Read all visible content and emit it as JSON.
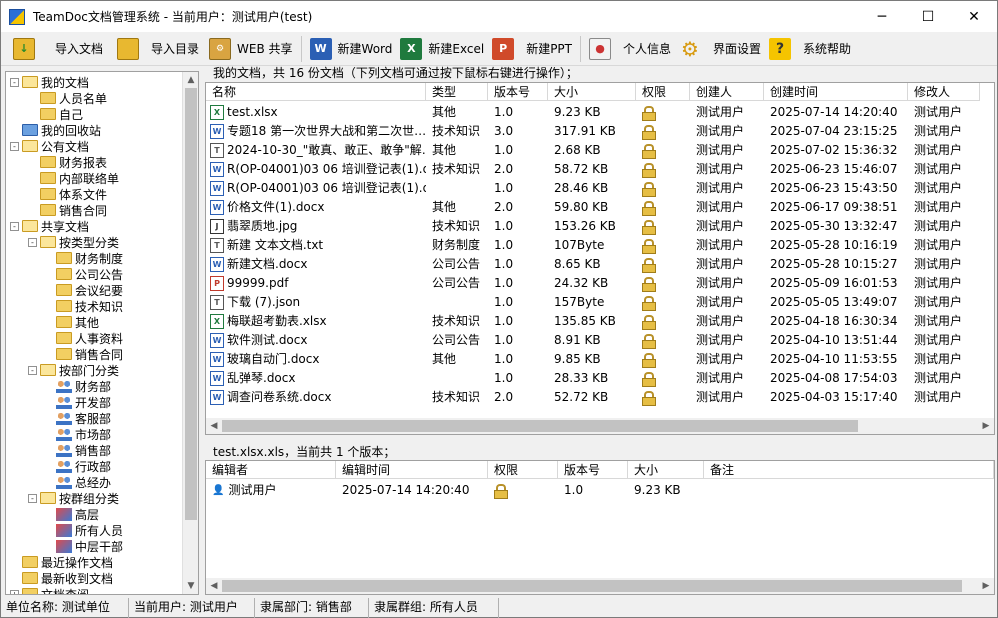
{
  "window": {
    "title": "TeamDoc文档管理系统 - 当前用户：测试用户(test)",
    "minimize": "─",
    "maximize": "☐",
    "close": "✕"
  },
  "toolbar": {
    "items": [
      {
        "label": "导入文档",
        "icon": "import-doc-icon"
      },
      {
        "label": "导入目录",
        "icon": "import-folder-icon"
      },
      {
        "label": "WEB 共享",
        "icon": "web-share-icon"
      },
      {
        "label": "新建Word",
        "icon": "word-icon"
      },
      {
        "label": "新建Excel",
        "icon": "excel-icon"
      },
      {
        "label": "新建PPT",
        "icon": "ppt-icon"
      },
      {
        "label": "个人信息",
        "icon": "user-info-icon"
      },
      {
        "label": "界面设置",
        "icon": "gear-icon"
      },
      {
        "label": "系统帮助",
        "icon": "help-icon"
      }
    ]
  },
  "tree": {
    "nodes": [
      {
        "label": "我的文档",
        "level": 0,
        "exp": "-",
        "icon": "folder-open"
      },
      {
        "label": "人员名单",
        "level": 1,
        "exp": "",
        "icon": "folder"
      },
      {
        "label": "自己",
        "level": 1,
        "exp": "",
        "icon": "folder"
      },
      {
        "label": "我的回收站",
        "level": 0,
        "exp": "",
        "icon": "recycle"
      },
      {
        "label": "公有文档",
        "level": 0,
        "exp": "-",
        "icon": "folder-open"
      },
      {
        "label": "财务报表",
        "level": 1,
        "exp": "",
        "icon": "folder"
      },
      {
        "label": "内部联络单",
        "level": 1,
        "exp": "",
        "icon": "folder"
      },
      {
        "label": "体系文件",
        "level": 1,
        "exp": "",
        "icon": "folder"
      },
      {
        "label": "销售合同",
        "level": 1,
        "exp": "",
        "icon": "folder"
      },
      {
        "label": "共享文档",
        "level": 0,
        "exp": "-",
        "icon": "folder-open"
      },
      {
        "label": "按类型分类",
        "level": 1,
        "exp": "-",
        "icon": "folder-open"
      },
      {
        "label": "财务制度",
        "level": 2,
        "exp": "",
        "icon": "folder"
      },
      {
        "label": "公司公告",
        "level": 2,
        "exp": "",
        "icon": "folder"
      },
      {
        "label": "会议纪要",
        "level": 2,
        "exp": "",
        "icon": "folder"
      },
      {
        "label": "技术知识",
        "level": 2,
        "exp": "",
        "icon": "folder"
      },
      {
        "label": "其他",
        "level": 2,
        "exp": "",
        "icon": "folder"
      },
      {
        "label": "人事资料",
        "level": 2,
        "exp": "",
        "icon": "folder"
      },
      {
        "label": "销售合同",
        "level": 2,
        "exp": "",
        "icon": "folder"
      },
      {
        "label": "按部门分类",
        "level": 1,
        "exp": "-",
        "icon": "folder-open"
      },
      {
        "label": "财务部",
        "level": 2,
        "exp": "",
        "icon": "people"
      },
      {
        "label": "开发部",
        "level": 2,
        "exp": "",
        "icon": "people"
      },
      {
        "label": "客服部",
        "level": 2,
        "exp": "",
        "icon": "people"
      },
      {
        "label": "市场部",
        "level": 2,
        "exp": "",
        "icon": "people"
      },
      {
        "label": "销售部",
        "level": 2,
        "exp": "",
        "icon": "people"
      },
      {
        "label": "行政部",
        "level": 2,
        "exp": "",
        "icon": "people"
      },
      {
        "label": "总经办",
        "level": 2,
        "exp": "",
        "icon": "people"
      },
      {
        "label": "按群组分类",
        "level": 1,
        "exp": "-",
        "icon": "folder-open"
      },
      {
        "label": "高层",
        "level": 2,
        "exp": "",
        "icon": "group"
      },
      {
        "label": "所有人员",
        "level": 2,
        "exp": "",
        "icon": "group"
      },
      {
        "label": "中层干部",
        "level": 2,
        "exp": "",
        "icon": "group"
      },
      {
        "label": "最近操作文档",
        "level": 0,
        "exp": "",
        "icon": "folder"
      },
      {
        "label": "最新收到文档",
        "level": 0,
        "exp": "",
        "icon": "folder"
      },
      {
        "label": "文档查阅",
        "level": 0,
        "exp": "+",
        "icon": "folder"
      }
    ]
  },
  "docs": {
    "caption": "我的文档，共 16 份文档（下列文档可通过按下鼠标右键进行操作）；",
    "columns": [
      "名称",
      "类型",
      "版本号",
      "大小",
      "权限",
      "创建人",
      "创建时间",
      "修改人"
    ],
    "rows": [
      {
        "name": "test.xlsx",
        "ext": "X",
        "type": "其他",
        "ver": "1.0",
        "size": "9.23 KB",
        "creator": "测试用户",
        "time": "2025-07-14 14:20:40",
        "modifier": "测试用户"
      },
      {
        "name": "专题18 第一次世界大战和第二次世…",
        "ext": "W",
        "type": "技术知识",
        "ver": "3.0",
        "size": "317.91 KB",
        "creator": "测试用户",
        "time": "2025-07-04 23:15:25",
        "modifier": "测试用户"
      },
      {
        "name": "2024-10-30_\"敢真、敢正、敢争\"解…",
        "ext": "T",
        "type": "其他",
        "ver": "1.0",
        "size": "2.68 KB",
        "creator": "测试用户",
        "time": "2025-07-02 15:36:32",
        "modifier": "测试用户"
      },
      {
        "name": "R(OP-04001)03 06 培训登记表(1).docx",
        "ext": "W",
        "type": "技术知识",
        "ver": "2.0",
        "size": "58.72 KB",
        "creator": "测试用户",
        "time": "2025-06-23 15:46:07",
        "modifier": "测试用户"
      },
      {
        "name": "R(OP-04001)03 06 培训登记表(1).docx",
        "ext": "W",
        "type": "",
        "ver": "1.0",
        "size": "28.46 KB",
        "creator": "测试用户",
        "time": "2025-06-23 15:43:50",
        "modifier": "测试用户"
      },
      {
        "name": "价格文件(1).docx",
        "ext": "W",
        "type": "其他",
        "ver": "2.0",
        "size": "59.80 KB",
        "creator": "测试用户",
        "time": "2025-06-17 09:38:51",
        "modifier": "测试用户"
      },
      {
        "name": "翡翠质地.jpg",
        "ext": "J",
        "type": "技术知识",
        "ver": "1.0",
        "size": "153.26 KB",
        "creator": "测试用户",
        "time": "2025-05-30 13:32:47",
        "modifier": "测试用户"
      },
      {
        "name": "新建 文本文档.txt",
        "ext": "T",
        "type": "财务制度",
        "ver": "1.0",
        "size": "107Byte",
        "creator": "测试用户",
        "time": "2025-05-28 10:16:19",
        "modifier": "测试用户"
      },
      {
        "name": "新建文档.docx",
        "ext": "W",
        "type": "公司公告",
        "ver": "1.0",
        "size": "8.65 KB",
        "creator": "测试用户",
        "time": "2025-05-28 10:15:27",
        "modifier": "测试用户"
      },
      {
        "name": "99999.pdf",
        "ext": "P",
        "type": "公司公告",
        "ver": "1.0",
        "size": "24.32 KB",
        "creator": "测试用户",
        "time": "2025-05-09 16:01:53",
        "modifier": "测试用户"
      },
      {
        "name": "下载 (7).json",
        "ext": "T",
        "type": "",
        "ver": "1.0",
        "size": "157Byte",
        "creator": "测试用户",
        "time": "2025-05-05 13:49:07",
        "modifier": "测试用户"
      },
      {
        "name": "梅联超考勤表.xlsx",
        "ext": "X",
        "type": "技术知识",
        "ver": "1.0",
        "size": "135.85 KB",
        "creator": "测试用户",
        "time": "2025-04-18 16:30:34",
        "modifier": "测试用户"
      },
      {
        "name": "软件测试.docx",
        "ext": "W",
        "type": "公司公告",
        "ver": "1.0",
        "size": "8.91 KB",
        "creator": "测试用户",
        "time": "2025-04-10 13:51:44",
        "modifier": "测试用户"
      },
      {
        "name": "玻璃自动门.docx",
        "ext": "W",
        "type": "其他",
        "ver": "1.0",
        "size": "9.85 KB",
        "creator": "测试用户",
        "time": "2025-04-10 11:53:55",
        "modifier": "测试用户"
      },
      {
        "name": "乱弹琴.docx",
        "ext": "W",
        "type": "",
        "ver": "1.0",
        "size": "28.33 KB",
        "creator": "测试用户",
        "time": "2025-04-08 17:54:03",
        "modifier": "测试用户"
      },
      {
        "name": "调查问卷系统.docx",
        "ext": "W",
        "type": "技术知识",
        "ver": "2.0",
        "size": "52.72 KB",
        "creator": "测试用户",
        "time": "2025-04-03 15:17:40",
        "modifier": "测试用户"
      }
    ]
  },
  "versions": {
    "caption": "test.xlsx.xls，当前共 1 个版本；",
    "columns": [
      "编辑者",
      "编辑时间",
      "权限",
      "版本号",
      "大小",
      "备注"
    ],
    "rows": [
      {
        "editor": "测试用户",
        "time": "2025-07-14 14:20:40",
        "ver": "1.0",
        "size": "9.23 KB",
        "note": ""
      }
    ]
  },
  "status": {
    "unit": "单位名称: 测试单位",
    "user": "当前用户: 测试用户",
    "dept": "隶属部门: 销售部",
    "group": "隶属群组: 所有人员"
  }
}
